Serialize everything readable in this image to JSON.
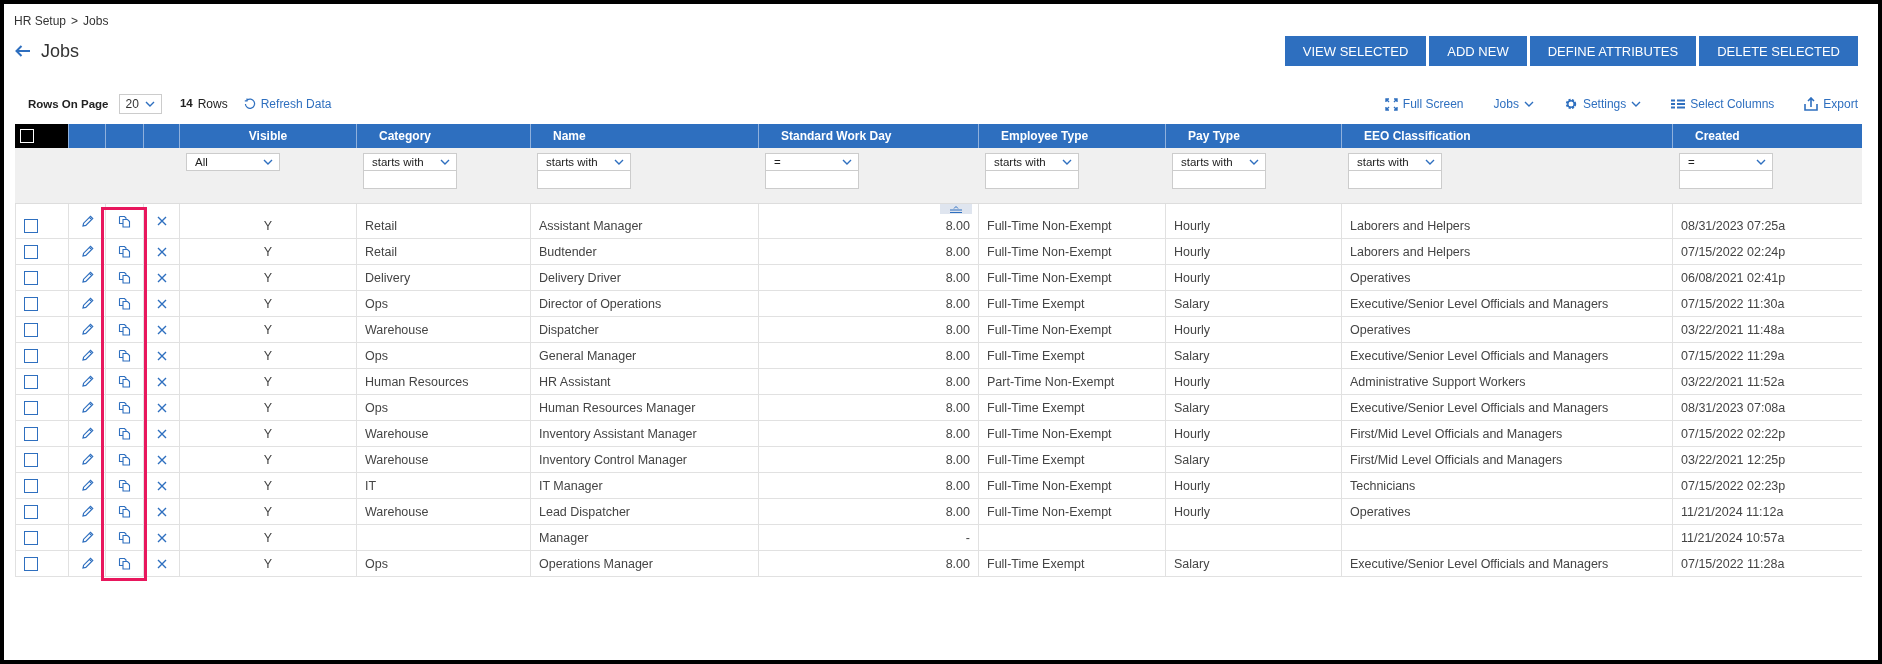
{
  "breadcrumb": {
    "items": [
      "HR Setup",
      "Jobs"
    ],
    "separator": ">"
  },
  "page_title": "Jobs",
  "actions": [
    "VIEW SELECTED",
    "ADD NEW",
    "DEFINE ATTRIBUTES",
    "DELETE SELECTED"
  ],
  "toolbar": {
    "rows_on_page_label": "Rows On Page",
    "rows_on_page": "20",
    "row_count": "14",
    "row_count_label": "Rows",
    "refresh": "Refresh Data",
    "tools": [
      {
        "kind": "fullscreen",
        "label": "Full Screen"
      },
      {
        "kind": "menu",
        "label": "Jobs"
      },
      {
        "kind": "settings",
        "label": "Settings"
      },
      {
        "kind": "columns",
        "label": "Select Columns"
      },
      {
        "kind": "export",
        "label": "Export"
      }
    ]
  },
  "table": {
    "select_all_checked": false,
    "row_actions": [
      {
        "kind": "edit",
        "highlighted": false
      },
      {
        "kind": "copy",
        "highlighted": true
      },
      {
        "kind": "delete",
        "highlighted": false
      }
    ],
    "columns": [
      {
        "label": "Visible",
        "filter": {
          "operator": "All",
          "has_input": false
        }
      },
      {
        "label": "Category",
        "filter": {
          "operator": "starts with",
          "has_input": true
        }
      },
      {
        "label": "Name",
        "filter": {
          "operator": "starts with",
          "has_input": true
        }
      },
      {
        "label": "Standard Work Day",
        "filter": {
          "operator": "=",
          "has_input": true
        }
      },
      {
        "label": "Employee Type",
        "filter": {
          "operator": "starts with",
          "has_input": true
        }
      },
      {
        "label": "Pay Type",
        "filter": {
          "operator": "starts with",
          "has_input": true
        }
      },
      {
        "label": "EEO Classification",
        "filter": {
          "operator": "starts with",
          "has_input": true
        }
      },
      {
        "label": "Created",
        "filter": {
          "operator": "=",
          "has_input": true
        }
      }
    ],
    "rows": [
      {
        "checked": false,
        "cells": [
          "Y",
          "Retail",
          "Assistant Manager",
          "8.00",
          "Full-Time Non-Exempt",
          "Hourly",
          "Laborers and Helpers",
          "08/31/2023 07:25a"
        ]
      },
      {
        "checked": false,
        "cells": [
          "Y",
          "Retail",
          "Budtender",
          "8.00",
          "Full-Time Non-Exempt",
          "Hourly",
          "Laborers and Helpers",
          "07/15/2022 02:24p"
        ]
      },
      {
        "checked": false,
        "cells": [
          "Y",
          "Delivery",
          "Delivery Driver",
          "8.00",
          "Full-Time Non-Exempt",
          "Hourly",
          "Operatives",
          "06/08/2021 02:41p"
        ]
      },
      {
        "checked": false,
        "cells": [
          "Y",
          "Ops",
          "Director of Operations",
          "8.00",
          "Full-Time Exempt",
          "Salary",
          "Executive/Senior Level Officials and Managers",
          "07/15/2022 11:30a"
        ]
      },
      {
        "checked": false,
        "cells": [
          "Y",
          "Warehouse",
          "Dispatcher",
          "8.00",
          "Full-Time Non-Exempt",
          "Hourly",
          "Operatives",
          "03/22/2021 11:48a"
        ]
      },
      {
        "checked": false,
        "cells": [
          "Y",
          "Ops",
          "General Manager",
          "8.00",
          "Full-Time Exempt",
          "Salary",
          "Executive/Senior Level Officials and Managers",
          "07/15/2022 11:29a"
        ]
      },
      {
        "checked": false,
        "cells": [
          "Y",
          "Human Resources",
          "HR Assistant",
          "8.00",
          "Part-Time Non-Exempt",
          "Hourly",
          "Administrative Support Workers",
          "03/22/2021 11:52a"
        ]
      },
      {
        "checked": false,
        "cells": [
          "Y",
          "Ops",
          "Human Resources Manager",
          "8.00",
          "Full-Time Exempt",
          "Salary",
          "Executive/Senior Level Officials and Managers",
          "08/31/2023 07:08a"
        ]
      },
      {
        "checked": false,
        "cells": [
          "Y",
          "Warehouse",
          "Inventory Assistant Manager",
          "8.00",
          "Full-Time Non-Exempt",
          "Hourly",
          "First/Mid Level Officials and Managers",
          "07/15/2022 02:22p"
        ]
      },
      {
        "checked": false,
        "cells": [
          "Y",
          "Warehouse",
          "Inventory Control Manager",
          "8.00",
          "Full-Time Exempt",
          "Salary",
          "First/Mid Level Officials and Managers",
          "03/22/2021 12:25p"
        ]
      },
      {
        "checked": false,
        "cells": [
          "Y",
          "IT",
          "IT Manager",
          "8.00",
          "Full-Time Non-Exempt",
          "Hourly",
          "Technicians",
          "07/15/2022 02:23p"
        ]
      },
      {
        "checked": false,
        "cells": [
          "Y",
          "Warehouse",
          "Lead Dispatcher",
          "8.00",
          "Full-Time Non-Exempt",
          "Hourly",
          "Operatives",
          "11/21/2024 11:12a"
        ]
      },
      {
        "checked": false,
        "cells": [
          "Y",
          null,
          "Manager",
          "-",
          null,
          null,
          null,
          "11/21/2024 10:57a"
        ]
      },
      {
        "checked": false,
        "cells": [
          "Y",
          "Ops",
          "Operations Manager",
          "8.00",
          "Full-Time Exempt",
          "Salary",
          "Executive/Senior Level Officials and Managers",
          "07/15/2022 11:28a"
        ]
      }
    ]
  }
}
